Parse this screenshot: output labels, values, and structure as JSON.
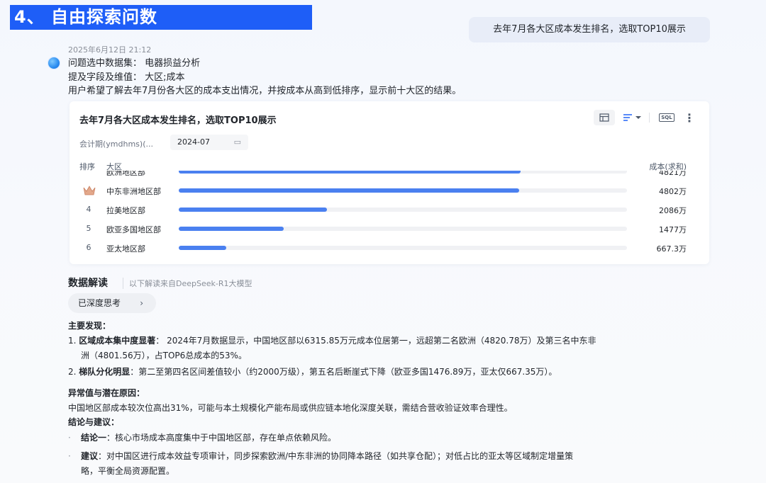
{
  "banner": {
    "title": "4、 自由探索问数"
  },
  "user_message": "去年7月各大区成本发生排名，选取TOP10展示",
  "response": {
    "timestamp": "2025年6月12日 21:12",
    "dataset_line": "问题选中数据集： 电器损益分析",
    "fields_line": "提及字段及维值： 大区;成本",
    "summary_line": "用户希望了解去年7月份各大区的成本支出情况，并按成本从高到低排序，显示前十大区的结果。"
  },
  "card": {
    "title": "去年7月各大区成本发生排名，选取TOP10展示",
    "tools": {
      "table_icon": "table-icon",
      "sort_icon": "sort-icon",
      "sql_label": "SQL",
      "more_icon": "more-icon"
    },
    "filter": {
      "label": "会计期(ymdhms)(...",
      "value": "2024-07"
    },
    "headers": {
      "rank": "排序",
      "region": "大区",
      "cost": "成本(求和)"
    },
    "rows": [
      {
        "rank": "",
        "name": "欧洲地区部",
        "value": "4821万",
        "fraction": 0.763
      },
      {
        "rank": "",
        "name": "中东非洲地区部",
        "value": "4802万",
        "fraction": 0.76,
        "icon": "crown-icon"
      },
      {
        "rank": "4",
        "name": "拉美地区部",
        "value": "2086万",
        "fraction": 0.33
      },
      {
        "rank": "5",
        "name": "欧亚多国地区部",
        "value": "1477万",
        "fraction": 0.234
      },
      {
        "rank": "6",
        "name": "亚太地区部",
        "value": "667.3万",
        "fraction": 0.106
      }
    ]
  },
  "interpretation": {
    "title": "数据解读",
    "source": "以下解读来自DeepSeek-R1大模型",
    "think_button": "已深度思考",
    "findings_title": "主要发现：",
    "finding1_head": "区域成本集中度显著",
    "finding1_text": "： 2024年7月数据显示，中国地区部以6315.85万元成本位居第一，远超第二名欧洲（4820.78万）及第三名中东非",
    "finding1_text2": "洲（4801.56万），占TOP6总成本的53%。",
    "finding2_head": "梯队分化明显",
    "finding2_text": "：第二至第四名区间差值较小（约2000万级），第五名后断崖式下降（欧亚多国1476.89万，亚太仅667.35万）。",
    "anomaly_title": "异常值与潜在原因：",
    "anomaly_text": "中国地区部成本较次位高出31%，可能与本土规模化产能布局或供应链本地化深度关联，需结合营收验证效率合理性。",
    "conclusion_title": "结论与建议：",
    "conclusion1_head": "结论一",
    "conclusion1_text": "：核心市场成本高度集中于中国地区部，存在单点依赖风险。",
    "suggestion_head": "建议",
    "suggestion_text": "：对中国区进行成本效益专项审计，同步探索欧洲/中东非洲的协同降本路径（如共享仓配）；对低占比的亚太等区域制定增量策",
    "suggestion_text2": "略，平衡全局资源配置。"
  }
}
